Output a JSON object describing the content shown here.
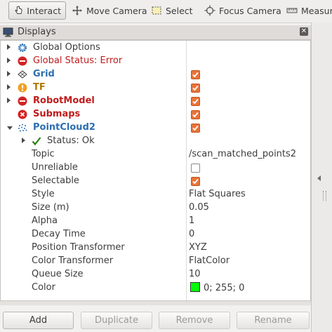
{
  "toolbar": {
    "interact": "Interact",
    "move_camera": "Move Camera",
    "select": "Select",
    "focus_camera": "Focus Camera",
    "measure": "Measure"
  },
  "panel": {
    "title": "Displays"
  },
  "tree": {
    "global_options": "Global Options",
    "global_status": "Global Status: Error",
    "grid": "Grid",
    "tf": "TF",
    "robot_model": "RobotModel",
    "submaps": "Submaps",
    "pointcloud": "PointCloud2",
    "status_ok": "Status: Ok",
    "props": [
      {
        "label": "Topic",
        "value": "/scan_matched_points2"
      },
      {
        "label": "Unreliable",
        "value": ""
      },
      {
        "label": "Selectable",
        "value": ""
      },
      {
        "label": "Style",
        "value": "Flat Squares"
      },
      {
        "label": "Size (m)",
        "value": "0.05"
      },
      {
        "label": "Alpha",
        "value": "1"
      },
      {
        "label": "Decay Time",
        "value": "0"
      },
      {
        "label": "Position Transformer",
        "value": "XYZ"
      },
      {
        "label": "Color Transformer",
        "value": "FlatColor"
      },
      {
        "label": "Queue Size",
        "value": "10"
      },
      {
        "label": "Color",
        "value": "0; 255; 0"
      }
    ],
    "checkboxes": {
      "grid": true,
      "tf": true,
      "robot_model": true,
      "submaps": true,
      "pointcloud": true,
      "unreliable": false,
      "selectable": true
    },
    "color_swatch": "#00ff00"
  },
  "buttons": {
    "add": "Add",
    "duplicate": "Duplicate",
    "remove": "Remove",
    "rename": "Rename"
  },
  "colors": {
    "accent_checkbox": "#e8743b",
    "error_red": "#c01c1c",
    "link_blue": "#2a6fb0",
    "warn_gold": "#b07800"
  }
}
